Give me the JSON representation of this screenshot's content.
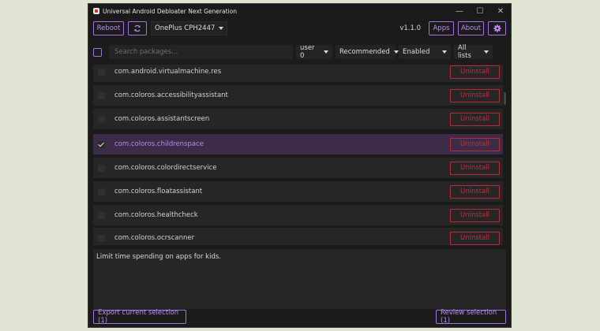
{
  "window": {
    "title": "Universal Android Debloater Next Generation",
    "controls": {
      "minimize": "—",
      "maximize": "☐",
      "close": "✕"
    }
  },
  "toolbar": {
    "reboot_label": "Reboot",
    "refresh_icon": "refresh-icon",
    "device": "OnePlus CPH2447",
    "version": "v1.1.0",
    "apps_label": "Apps",
    "about_label": "About",
    "settings_icon": "gear-icon"
  },
  "filters": {
    "search_placeholder": "Search packages...",
    "user": "user 0",
    "removal": "Recommended",
    "state": "Enabled",
    "list": "All lists"
  },
  "packages": [
    {
      "name": "com.android.virtualmachine.res",
      "selected": false,
      "action": "Uninstall"
    },
    {
      "name": "com.coloros.accessibilityassistant",
      "selected": false,
      "action": "Uninstall"
    },
    {
      "name": "com.coloros.assistantscreen",
      "selected": false,
      "action": "Uninstall"
    },
    {
      "name": "com.coloros.childrenspace",
      "selected": true,
      "action": "Uninstall"
    },
    {
      "name": "com.coloros.colordirectservice",
      "selected": false,
      "action": "Uninstall"
    },
    {
      "name": "com.coloros.floatassistant",
      "selected": false,
      "action": "Uninstall"
    },
    {
      "name": "com.coloros.healthcheck",
      "selected": false,
      "action": "Uninstall"
    },
    {
      "name": "com.coloros.ocrscanner",
      "selected": false,
      "action": "Uninstall"
    }
  ],
  "description": "Limit time spending on apps for kids.",
  "footer": {
    "export_label": "Export current selection (1)",
    "review_label": "Review selection (1)"
  },
  "colors": {
    "accent": "#a572e0",
    "danger": "#b52b3a",
    "background": "#1b1b1b",
    "selected_row": "#3d2c48"
  }
}
